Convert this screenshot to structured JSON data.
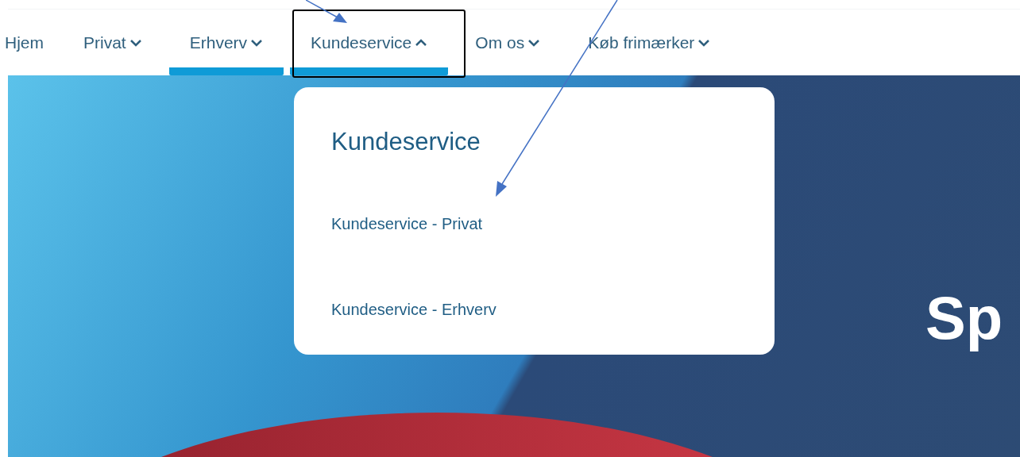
{
  "nav": [
    {
      "label": "Hjem",
      "has_menu": false,
      "underlined": false,
      "expanded": false
    },
    {
      "label": "Privat",
      "has_menu": true,
      "underlined": false,
      "expanded": false
    },
    {
      "label": "Erhverv",
      "has_menu": true,
      "underlined": true,
      "expanded": false
    },
    {
      "label": "Kundeservice",
      "has_menu": true,
      "underlined": true,
      "expanded": true
    },
    {
      "label": "Om os",
      "has_menu": true,
      "underlined": false,
      "expanded": false
    },
    {
      "label": "Køb frimærker",
      "has_menu": true,
      "underlined": false,
      "expanded": false
    }
  ],
  "dropdown": {
    "title": "Kundeservice",
    "links": [
      "Kundeservice - Privat",
      "Kundeservice - Erhverv"
    ]
  },
  "hero": {
    "heading": "Sp"
  }
}
